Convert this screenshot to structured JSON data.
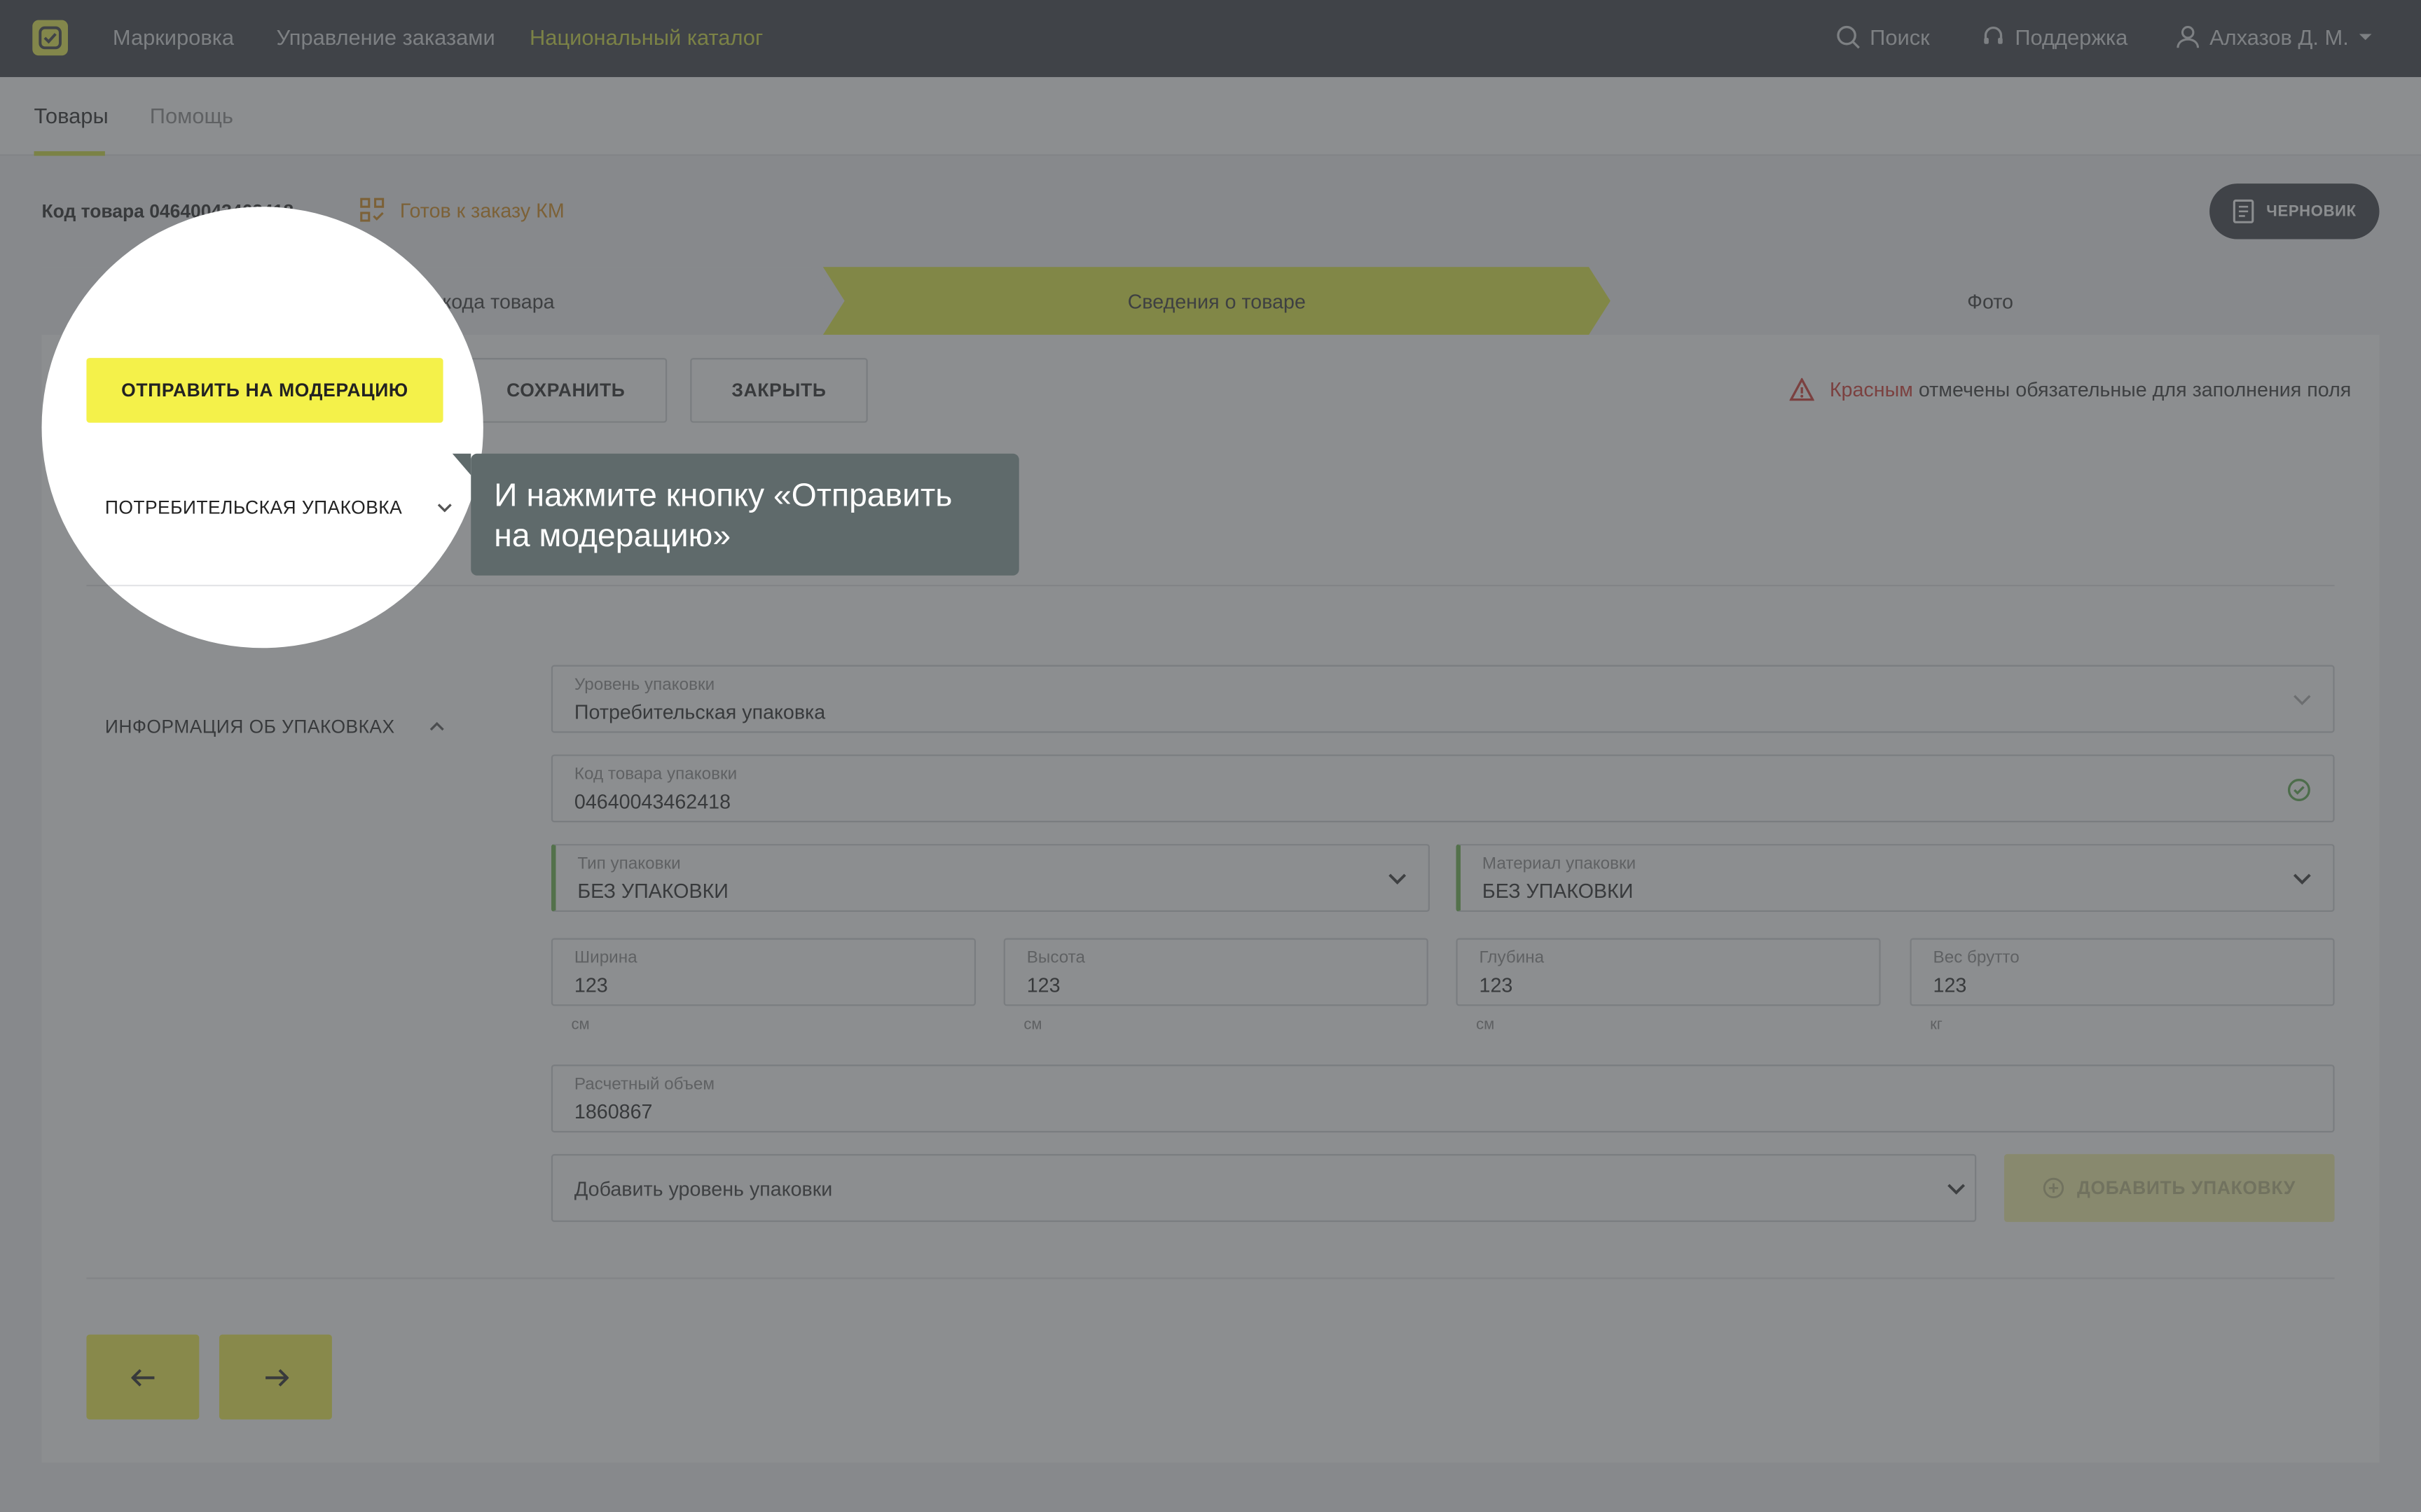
{
  "topnav": {
    "items": [
      "Маркировка",
      "Управление заказами",
      "Национальный каталог"
    ],
    "search": "Поиск",
    "support": "Поддержка",
    "user": "Алхазов Д. М."
  },
  "subnav": {
    "tabs": [
      "Товары",
      "Помощь"
    ]
  },
  "product": {
    "code_label": "Код товара 04640043462418",
    "status": "Готов к заказу КМ",
    "draft": "ЧЕРНОВИК"
  },
  "steps": [
    "Регистрация кода товара",
    "Сведения о товаре",
    "Фото"
  ],
  "actions": {
    "send": "ОТПРАВИТЬ НА МОДЕРАЦИЮ",
    "save": "СОХРАНИТЬ",
    "close": "ЗАКРЫТЬ"
  },
  "required_note": {
    "red": "Красным",
    "rest": "отмечены обязательные для заполнения поля"
  },
  "sections": {
    "consumer_pack": "ПОТРЕБИТЕЛЬСКАЯ УПАКОВКА",
    "pack_info": "ИНФОРМАЦИЯ ОБ УПАКОВКАХ"
  },
  "fields": {
    "level": {
      "label": "Уровень упаковки",
      "value": "Потребительская упаковка"
    },
    "code": {
      "label": "Код товара упаковки",
      "value": "04640043462418"
    },
    "type": {
      "label": "Тип упаковки",
      "value": "БЕЗ УПАКОВКИ"
    },
    "material": {
      "label": "Материал упаковки",
      "value": "БЕЗ УПАКОВКИ"
    },
    "width": {
      "label": "Ширина",
      "value": "123",
      "unit": "см"
    },
    "height": {
      "label": "Высота",
      "value": "123",
      "unit": "см"
    },
    "depth": {
      "label": "Глубина",
      "value": "123",
      "unit": "см"
    },
    "weight": {
      "label": "Вес брутто",
      "value": "123",
      "unit": "кг"
    },
    "volume": {
      "label": "Расчетный объем",
      "value": "1860867"
    }
  },
  "add_level": {
    "placeholder": "Добавить уровень упаковки",
    "button": "ДОБАВИТЬ УПАКОВКУ"
  },
  "tooltip": "И нажмите кнопку «Отправить на модерацию»",
  "colors": {
    "accent": "#f4f14a",
    "dark": "#373b42",
    "warning": "#d3362f",
    "status": "#d48a17"
  }
}
